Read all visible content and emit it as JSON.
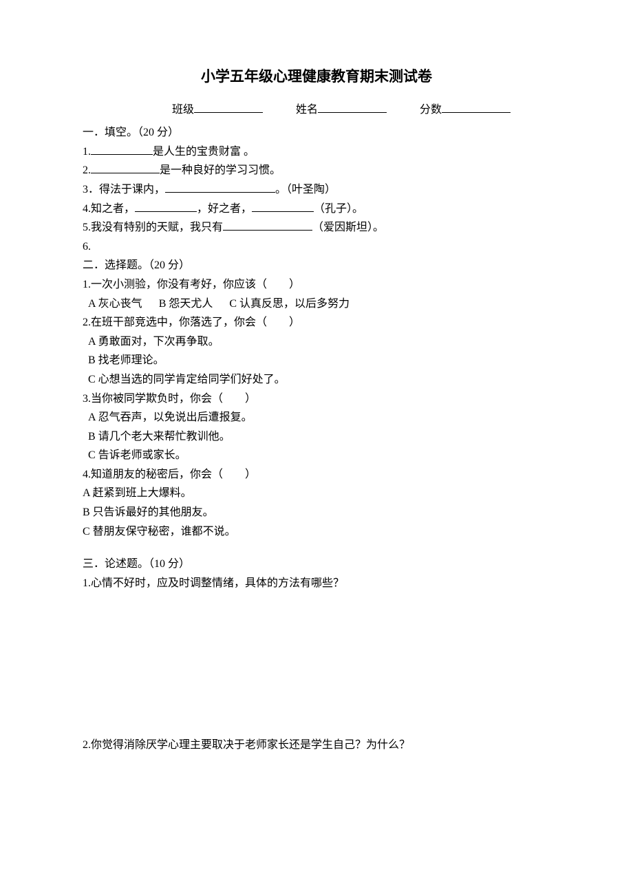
{
  "title": "小学五年级心理健康教育期末测试卷",
  "header": {
    "class_label": "班级",
    "name_label": "姓名",
    "score_label": "分数"
  },
  "section1": {
    "heading": "一．填空。（20 分）",
    "q1_pre": "1.",
    "q1_post": "是人生的宝贵财富 。",
    "q2_pre": "2.",
    "q2_post": "是一种良好的学习习惯。",
    "q3_pre": "3．得法于课内，",
    "q3_post": "。（叶圣陶）",
    "q4_pre": "4.知之者，",
    "q4_mid": "，好之者，",
    "q4_post": "（孔子）。",
    "q5_pre": "5.我没有特别的天赋，我只有",
    "q5_post": "（爱因斯坦）。",
    "q6": "6."
  },
  "section2": {
    "heading": "二．选择题。（20 分）",
    "q1": "1.一次小测验，你没有考好，你应该（　　）",
    "q1_a": "A 灰心丧气",
    "q1_b": "B 怨天尤人",
    "q1_c": "C 认真反思，以后多努力",
    "q2": "2.在班干部竞选中，你落选了，你会（　　）",
    "q2_a": "A 勇敢面对，下次再争取。",
    "q2_b": "B 找老师理论。",
    "q2_c": "C 心想当选的同学肯定给同学们好处了。",
    "q3": "3.当你被同学欺负时，你会（　　）",
    "q3_a": "A 忍气吞声，以免说出后遭报复。",
    "q3_b": "B 请几个老大来帮忙教训他。",
    "q3_c": "C 告诉老师或家长。",
    "q4": "4.知道朋友的秘密后，你会（　　）",
    "q4_a": "A 赶紧到班上大爆料。",
    "q4_b": "B 只告诉最好的其他朋友。",
    "q4_c": "C 替朋友保守秘密，谁都不说。"
  },
  "section3": {
    "heading": "三．论述题。（10 分）",
    "q1": "1.心情不好时，应及时调整情绪，具体的方法有哪些？",
    "q2": "2.你觉得消除厌学心理主要取决于老师家长还是学生自己？为什么？"
  }
}
